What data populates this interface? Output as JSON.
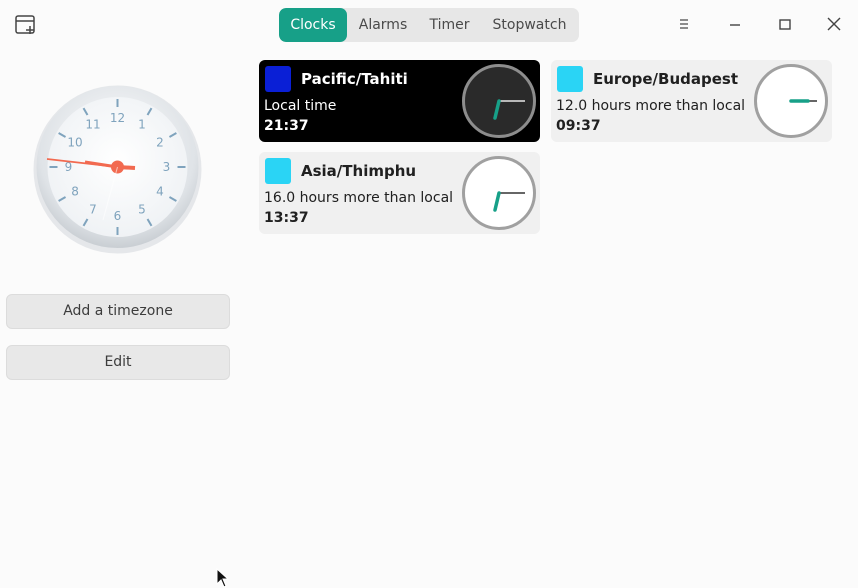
{
  "titlebar": {
    "tabs": [
      {
        "label": "Clocks",
        "active": true
      },
      {
        "label": "Alarms",
        "active": false
      },
      {
        "label": "Timer",
        "active": false
      },
      {
        "label": "Stopwatch",
        "active": false
      }
    ],
    "icons": [
      "add-window-icon",
      "menu-icon",
      "minimize-icon",
      "maximize-icon",
      "close-icon"
    ]
  },
  "local_clock": {
    "numerals": [
      "12",
      "1",
      "2",
      "3",
      "4",
      "5",
      "6",
      "7",
      "8",
      "9",
      "10",
      "11"
    ]
  },
  "sidebar": {
    "add_timezone_label": "Add a timezone",
    "edit_label": "Edit"
  },
  "clocks": [
    {
      "name": "Pacific/Tahiti",
      "diff": "Local time",
      "time": "21:37",
      "swatch": "#0a1fd6",
      "theme": "dark"
    },
    {
      "name": "Europe/Budapest",
      "diff": "12.0 hours more than local",
      "time": "09:37",
      "swatch": "#2ad4f5",
      "theme": "light"
    },
    {
      "name": "Asia/Thimphu",
      "diff": "16.0 hours more than local",
      "time": "13:37",
      "swatch": "#2ad4f5",
      "theme": "light"
    }
  ],
  "colors": {
    "accent": "#17a088",
    "second_hand": "#f26a50",
    "dark_card": "#000000",
    "light_card": "#f0f0f0"
  }
}
